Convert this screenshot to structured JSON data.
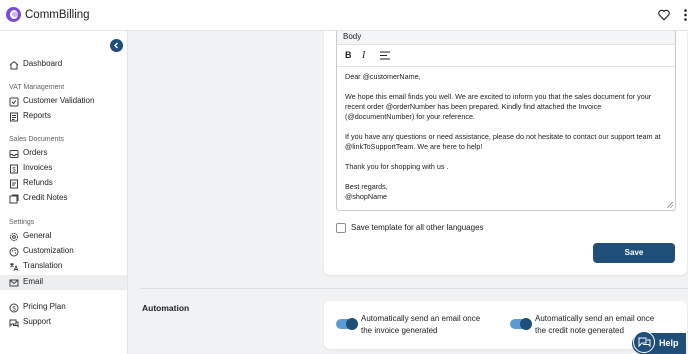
{
  "app": {
    "name": "CommBilling"
  },
  "sidebar": {
    "items_top": [
      {
        "label": "Dashboard",
        "icon": "home-icon"
      }
    ],
    "sections": [
      {
        "label": "VAT Management",
        "items": [
          {
            "label": "Customer Validation",
            "icon": "id-check-icon"
          },
          {
            "label": "Reports",
            "icon": "report-icon"
          }
        ]
      },
      {
        "label": "Sales Documents",
        "items": [
          {
            "label": "Orders",
            "icon": "inbox-icon"
          },
          {
            "label": "Invoices",
            "icon": "dollar-document-icon"
          },
          {
            "label": "Refunds",
            "icon": "refund-icon"
          },
          {
            "label": "Credit Notes",
            "icon": "notes-icon"
          }
        ]
      },
      {
        "label": "Settings",
        "items": [
          {
            "label": "General",
            "icon": "gear-icon"
          },
          {
            "label": "Customization",
            "icon": "palette-icon"
          },
          {
            "label": "Translation",
            "icon": "translate-icon"
          },
          {
            "label": "Email",
            "icon": "email-icon",
            "active": true
          }
        ]
      }
    ],
    "items_bottom": [
      {
        "label": "Pricing Plan",
        "icon": "pricing-icon"
      },
      {
        "label": "Support",
        "icon": "chat-icon"
      }
    ]
  },
  "editor": {
    "header": "Body",
    "toolbar": {
      "bold": "B",
      "italic": "I"
    },
    "body_lines": [
      "Dear @customerName,",
      "We hope this email finds you well. We are excited to inform you that the sales document for your recent order @orderNumber has been prepared. Kindly find attached the Invoice (@documentNumber) for your reference.",
      "If you have any questions or need assistance, please do not hesitate to contact our support team at @linkToSupportTeam. We are here to help!",
      "Thank you for shopping with us .",
      "Best regards,",
      "@shopName"
    ],
    "checkbox_label": "Save template for all other languages",
    "save_label": "Save"
  },
  "automation": {
    "title": "Automation",
    "toggles": [
      {
        "label": "Automatically send an email once the invoice generated",
        "on": true
      },
      {
        "label": "Automatically send an email once the credit note generated",
        "on": true
      }
    ]
  },
  "help": {
    "label": "Help"
  },
  "colors": {
    "primary": "#1f4e79",
    "toggle_track": "#5b9bd5",
    "brand": "#7a4bd8"
  }
}
